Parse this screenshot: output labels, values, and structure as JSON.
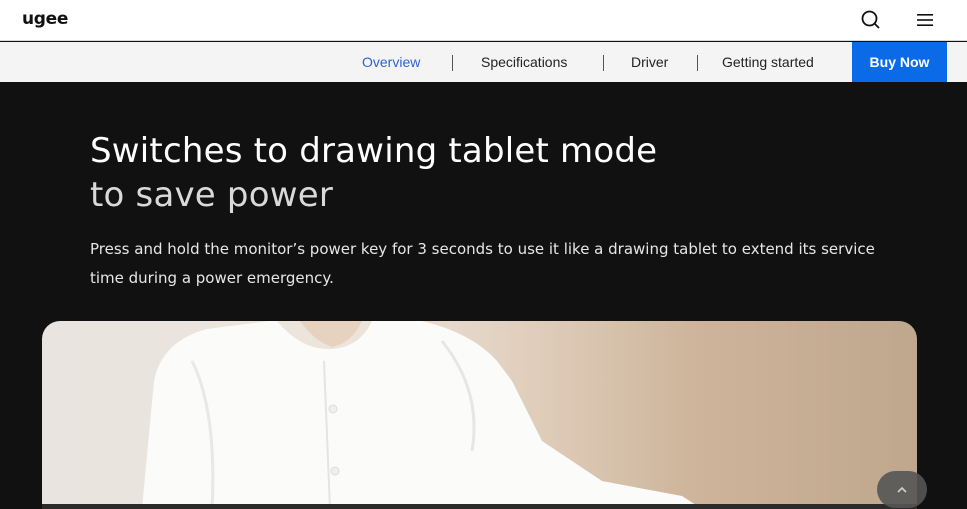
{
  "brand": {
    "logo_text": "ugee"
  },
  "header": {
    "search_icon": "search-icon",
    "menu_icon": "hamburger-menu-icon"
  },
  "subnav": {
    "items": [
      "Overview",
      "Specifications",
      "Driver",
      "Getting started"
    ],
    "active": "Overview",
    "buy_label": "Buy Now"
  },
  "hero": {
    "headline_line1": "Switches to drawing tablet mode",
    "headline_line2": "to save power",
    "description": "Press and hold the monitor’s power key for 3 seconds to use it like a drawing tablet to extend its service time during a power emergency."
  },
  "scroll_top_icon": "chevron-up-icon",
  "colors": {
    "accent": "#0a6ae8",
    "active_link": "#2f62d6",
    "hero_bg": "#111111"
  }
}
